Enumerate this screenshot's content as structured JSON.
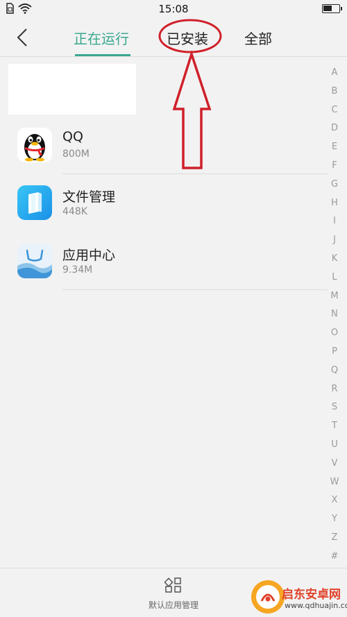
{
  "status_bar": {
    "time": "15:08"
  },
  "tabs": {
    "running": "正在运行",
    "installed": "已安装",
    "all": "全部"
  },
  "apps": [
    {
      "name": "QQ",
      "size": "800M",
      "icon": "qq-penguin-icon"
    },
    {
      "name": "文件管理",
      "size": "448K",
      "icon": "file-manager-icon"
    },
    {
      "name": "应用中心",
      "size": "9.34M",
      "icon": "app-center-icon"
    }
  ],
  "alphabet": [
    "A",
    "B",
    "C",
    "D",
    "E",
    "F",
    "G",
    "H",
    "I",
    "J",
    "K",
    "L",
    "M",
    "N",
    "O",
    "P",
    "Q",
    "R",
    "S",
    "T",
    "U",
    "V",
    "W",
    "X",
    "Y",
    "Z",
    "#"
  ],
  "bottom_bar": {
    "default_apps_label": "默认应用管理"
  },
  "watermark": {
    "title": "启东安卓网",
    "url": "www.qdhuajin.com"
  },
  "colors": {
    "accent": "#3aa88f",
    "annotation_red": "#d0202a",
    "background": "#f2f2f2"
  }
}
